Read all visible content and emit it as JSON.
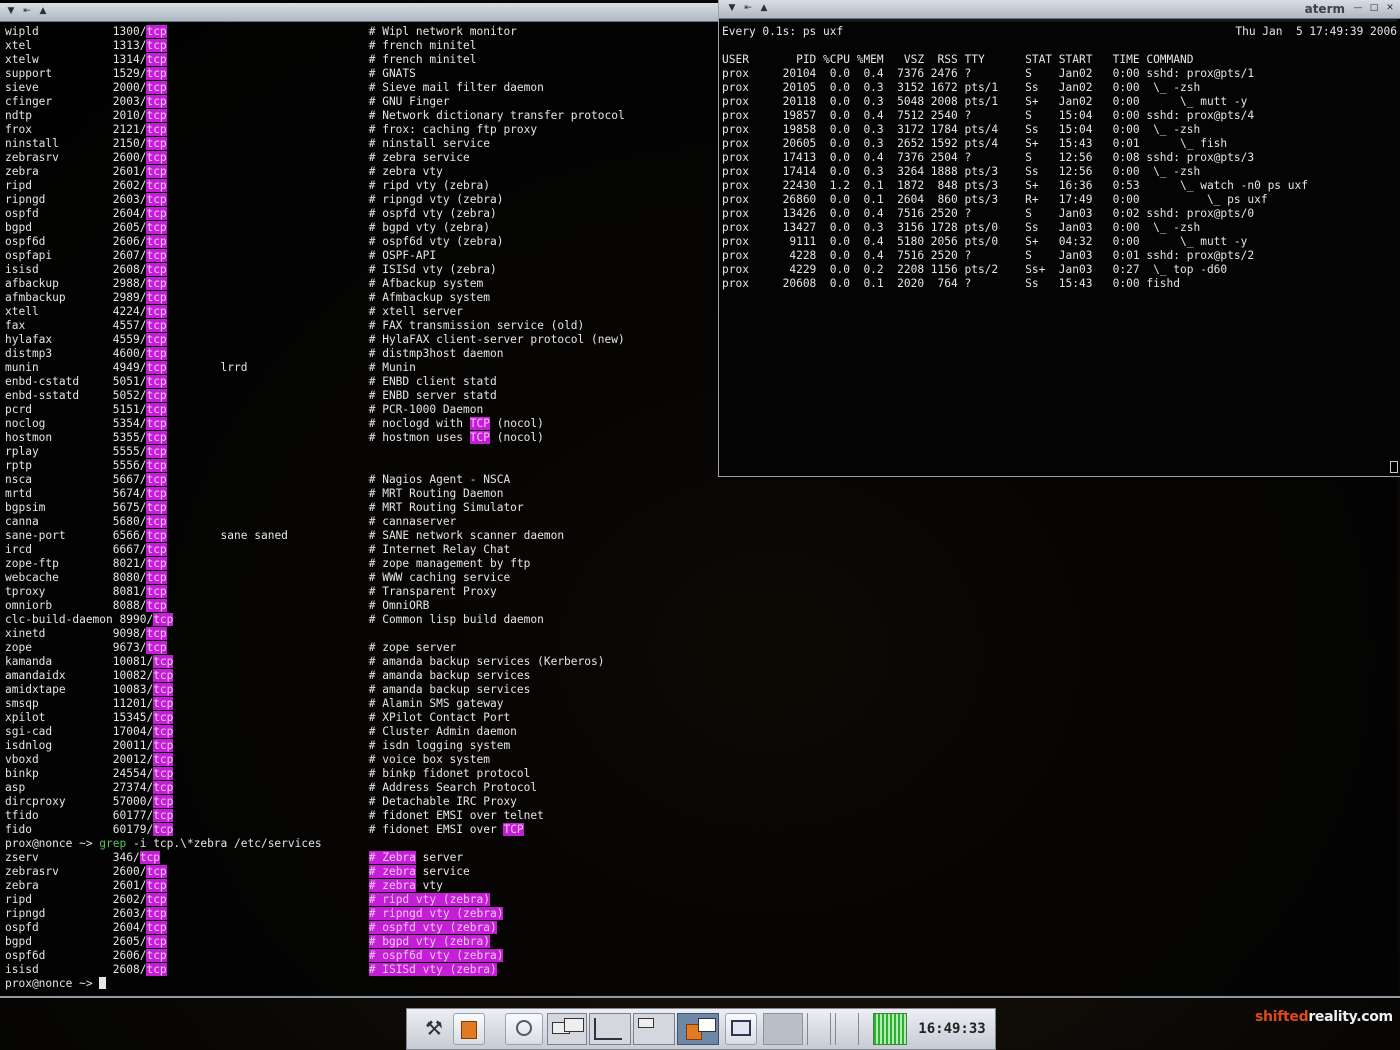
{
  "window_left": {
    "title": "",
    "lines": [
      {
        "text": "wipld           1300/"
      },
      {
        "text": "wipld           1300/tcp                              # Wipl network monitor"
      },
      {
        "text": "xtel            1313/tcp                              # french minitel"
      },
      {
        "text": "xtelw           1314/tcp                              # french minitel"
      },
      {
        "text": "support         1529/tcp                              # GNATS"
      },
      {
        "text": "sieve           2000/tcp                              # Sieve mail filter daemon"
      },
      {
        "text": "cfinger         2003/tcp                              # GNU Finger"
      },
      {
        "text": "ndtp            2010/tcp                              # Network dictionary transfer protocol"
      },
      {
        "text": "frox            2121/tcp                              # frox: caching ftp proxy"
      },
      {
        "text": "ninstall        2150/tcp                              # ninstall service"
      },
      {
        "text": "zebrasrv        2600/tcp                              # zebra service"
      },
      {
        "text": "zebra           2601/tcp                              # zebra vty"
      },
      {
        "text": "ripd            2602/tcp                              # ripd vty (zebra)"
      },
      {
        "text": "ripngd          2603/tcp                              # ripngd vty (zebra)"
      },
      {
        "text": "ospfd           2604/tcp                              # ospfd vty (zebra)"
      },
      {
        "text": "bgpd            2605/tcp                              # bgpd vty (zebra)"
      },
      {
        "text": "ospf6d          2606/tcp                              # ospf6d vty (zebra)"
      },
      {
        "text": "ospfapi         2607/tcp                              # OSPF-API"
      },
      {
        "text": "isisd           2608/tcp                              # ISISd vty (zebra)"
      },
      {
        "text": "afbackup        2988/tcp                              # Afbackup system"
      },
      {
        "text": "afmbackup       2989/tcp                              # Afmbackup system"
      },
      {
        "text": "xtell           4224/tcp                              # xtell server"
      },
      {
        "text": "fax             4557/tcp                              # FAX transmission service (old)"
      },
      {
        "text": "hylafax         4559/tcp                              # HylaFAX client-server protocol (new)"
      },
      {
        "text": "distmp3         4600/tcp                              # distmp3host daemon"
      },
      {
        "text": "munin           4949/tcp        lrrd                  # Munin"
      },
      {
        "text": "enbd-cstatd     5051/tcp                              # ENBD client statd"
      },
      {
        "text": "enbd-sstatd     5052/tcp                              # ENBD server statd"
      },
      {
        "text": "pcrd            5151/tcp                              # PCR-1000 Daemon"
      },
      {
        "text": "noclog          5354/tcp                              # noclogd with TCP (nocol)"
      },
      {
        "text": "hostmon         5355/tcp                              # hostmon uses TCP (nocol)"
      },
      {
        "text": "rplay           5555/tcp"
      },
      {
        "text": "rptp            5556/tcp"
      },
      {
        "text": "nsca            5667/tcp                              # Nagios Agent - NSCA"
      },
      {
        "text": "mrtd            5674/tcp                              # MRT Routing Daemon"
      },
      {
        "text": "bgpsim          5675/tcp                              # MRT Routing Simulator"
      },
      {
        "text": "canna           5680/tcp                              # cannaserver"
      },
      {
        "text": "sane-port       6566/tcp        sane saned            # SANE network scanner daemon"
      },
      {
        "text": "ircd            6667/tcp                              # Internet Relay Chat"
      },
      {
        "text": "zope-ftp        8021/tcp                              # zope management by ftp"
      },
      {
        "text": "webcache        8080/tcp                              # WWW caching service"
      },
      {
        "text": "tproxy          8081/tcp                              # Transparent Proxy"
      },
      {
        "text": "omniorb         8088/tcp                              # OmniORB"
      },
      {
        "text": "clc-build-daemon 8990/tcp                             # Common lisp build daemon"
      },
      {
        "text": "xinetd          9098/tcp"
      },
      {
        "text": "zope            9673/tcp                              # zope server"
      },
      {
        "text": "kamanda         10081/tcp                             # amanda backup services (Kerberos)"
      },
      {
        "text": "amandaidx       10082/tcp                             # amanda backup services"
      },
      {
        "text": "amidxtape       10083/tcp                             # amanda backup services"
      },
      {
        "text": "smsqp           11201/tcp                             # Alamin SMS gateway"
      },
      {
        "text": "xpilot          15345/tcp                             # XPilot Contact Port"
      },
      {
        "text": "sgi-cad         17004/tcp                             # Cluster Admin daemon"
      },
      {
        "text": "isdnlog         20011/tcp                             # isdn logging system"
      },
      {
        "text": "vboxd           20012/tcp                             # voice box system"
      },
      {
        "text": "binkp           24554/tcp                             # binkp fidonet protocol"
      },
      {
        "text": "asp             27374/tcp                             # Address Search Protocol"
      },
      {
        "text": "dircproxy       57000/tcp                             # Detachable IRC Proxy"
      },
      {
        "text": "tfido           60177/tcp                             # fidonet EMSI over telnet"
      },
      {
        "text": "fido            60179/tcp                             # fidonet EMSI over TCP"
      },
      {
        "text": "prox@nonce ~> grep -i tcp.\\*zebra /etc/services"
      },
      {
        "text": "zserv           346/tcp                               # Zebra server"
      },
      {
        "text": "zebrasrv        2600/tcp                              # zebra service"
      },
      {
        "text": "zebra           2601/tcp                              # zebra vty"
      },
      {
        "text": "ripd            2602/tcp                              # ripd vty (zebra)"
      },
      {
        "text": "ripngd          2603/tcp                              # ripngd vty (zebra)"
      },
      {
        "text": "ospfd           2604/tcp                              # ospfd vty (zebra)"
      },
      {
        "text": "bgpd            2605/tcp                              # bgpd vty (zebra)"
      },
      {
        "text": "ospf6d          2606/tcp                              # ospf6d vty (zebra)"
      },
      {
        "text": "isisd           2608/tcp                              # ISISd vty (zebra)"
      },
      {
        "text": "prox@nonce ~> "
      }
    ],
    "highlight_color": "#c41fd6",
    "prompt_cmd_color": "#55c455"
  },
  "window_right": {
    "title": "aterm",
    "watch_header": "Every 0.1s: ps uxf",
    "watch_date": "Thu Jan  5 17:49:39 2006",
    "ps_header": "USER       PID %CPU %MEM   VSZ  RSS TTY      STAT START   TIME COMMAND",
    "ps_rows": [
      "prox     20104  0.0  0.4  7376 2476 ?        S    Jan02   0:00 sshd: prox@pts/1",
      "prox     20105  0.0  0.3  3152 1672 pts/1    Ss   Jan02   0:00  \\_ -zsh",
      "prox     20118  0.0  0.3  5048 2008 pts/1    S+   Jan02   0:00      \\_ mutt -y",
      "prox     19857  0.0  0.4  7512 2540 ?        S    15:04   0:00 sshd: prox@pts/4",
      "prox     19858  0.0  0.3  3172 1784 pts/4    Ss   15:04   0:00  \\_ -zsh",
      "prox     20605  0.0  0.3  2652 1592 pts/4    S+   15:43   0:01      \\_ fish",
      "prox     17413  0.0  0.4  7376 2504 ?        S    12:56   0:08 sshd: prox@pts/3",
      "prox     17414  0.0  0.3  3264 1888 pts/3    Ss   12:56   0:00  \\_ -zsh",
      "prox     22430  1.2  0.1  1872  848 pts/3    S+   16:36   0:53      \\_ watch -n0 ps uxf",
      "prox     26860  0.0  0.1  2604  860 pts/3    R+   17:49   0:00          \\_ ps uxf",
      "prox     13426  0.0  0.4  7516 2520 ?        S    Jan03   0:02 sshd: prox@pts/0",
      "prox     13427  0.0  0.3  3156 1728 pts/0    Ss   Jan03   0:00  \\_ -zsh",
      "prox      9111  0.0  0.4  5180 2056 pts/0    S+   04:32   0:00      \\_ mutt -y",
      "prox      4228  0.0  0.4  7516 2520 ?        S    Jan03   0:01 sshd: prox@pts/2",
      "prox      4229  0.0  0.2  2208 1156 pts/2    Ss+  Jan03   0:27  \\_ top -d60",
      "prox     20608  0.0  0.1  2020  764 ?        Ss   15:43   0:00 fishd"
    ]
  },
  "taskbar": {
    "clock": "16:49:33",
    "launchers": [
      "tools-icon",
      "files-icon",
      "browser-icon"
    ],
    "task_icons": [
      "terminal-task-icon",
      "app-task-icon"
    ]
  },
  "watermark": {
    "part1": "shifted",
    "part2": "reality.com",
    "color1": "#e04a1a",
    "color2": "#f0f0f0"
  }
}
